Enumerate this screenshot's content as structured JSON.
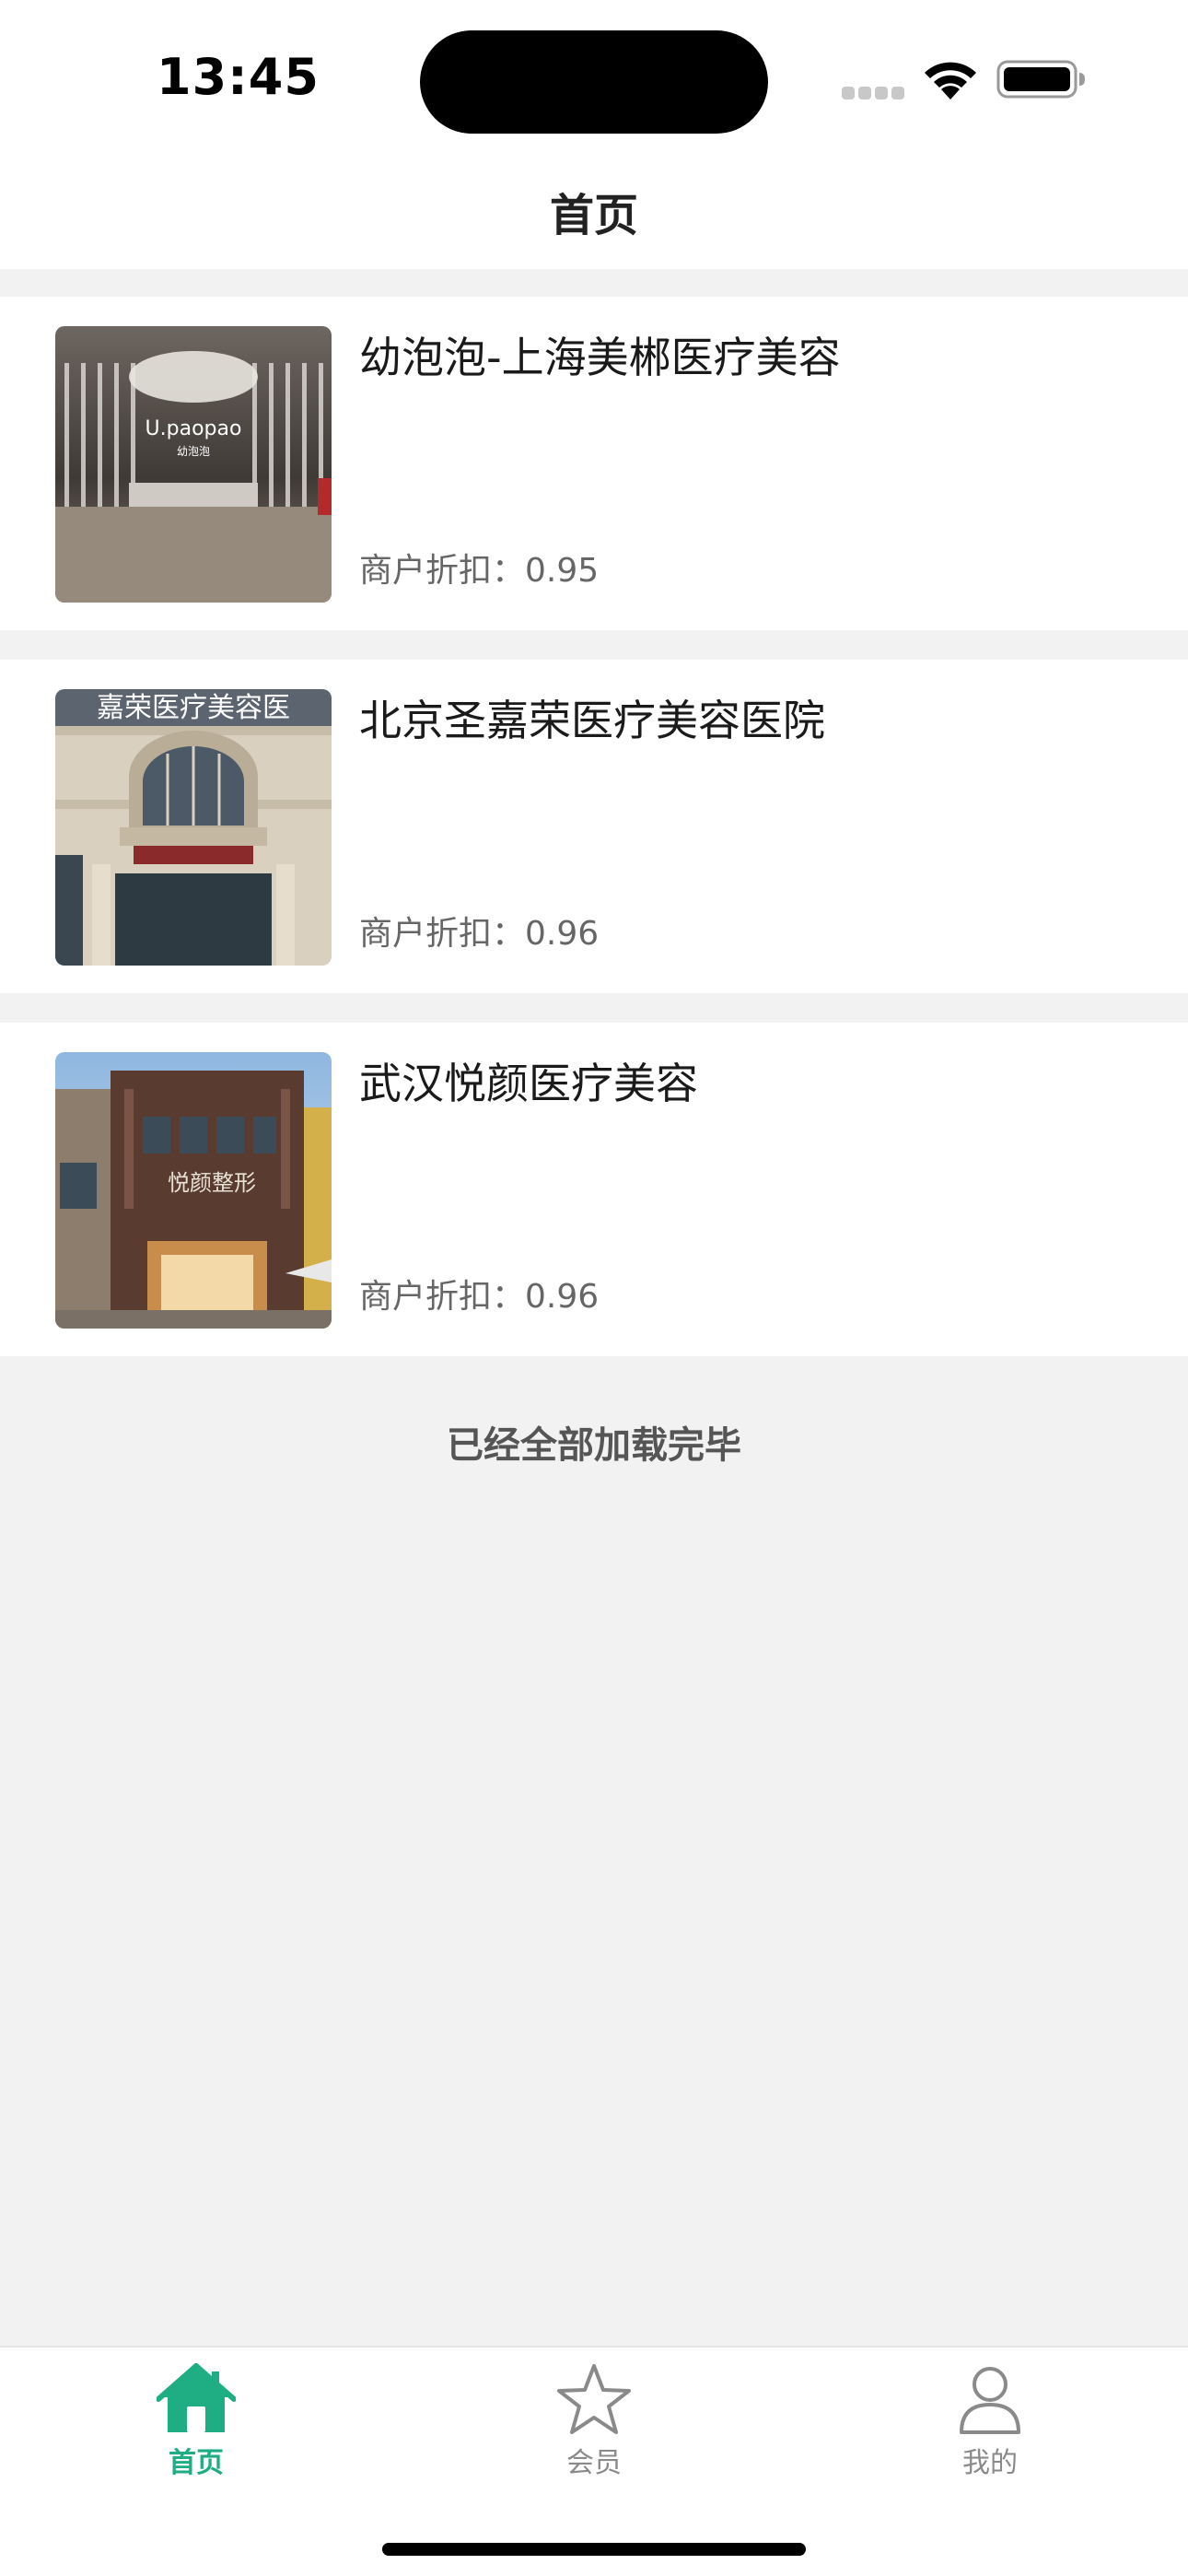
{
  "status_bar": {
    "time": "13:45"
  },
  "nav": {
    "title": "首页"
  },
  "merchants": [
    {
      "name": "幼泡泡-上海美郴医疗美容",
      "discount_label": "商户折扣：",
      "discount_value": "0.95",
      "sign_text": "U.paopao",
      "sign_subtext": "幼泡泡"
    },
    {
      "name": "北京圣嘉荣医疗美容医院",
      "discount_label": "商户折扣：",
      "discount_value": "0.96",
      "sign_text": "嘉荣医疗美容医"
    },
    {
      "name": "武汉悦颜医疗美容",
      "discount_label": "商户折扣：",
      "discount_value": "0.96",
      "sign_text": "悦颜整形"
    }
  ],
  "list_footer": "已经全部加载完毕",
  "tabs": [
    {
      "label": "首页",
      "icon": "home-icon",
      "active": true
    },
    {
      "label": "会员",
      "icon": "star-icon",
      "active": false
    },
    {
      "label": "我的",
      "icon": "user-icon",
      "active": false
    }
  ],
  "colors": {
    "accent": "#1fae84",
    "background": "#f2f2f2",
    "inactive": "#8a8a8a"
  }
}
